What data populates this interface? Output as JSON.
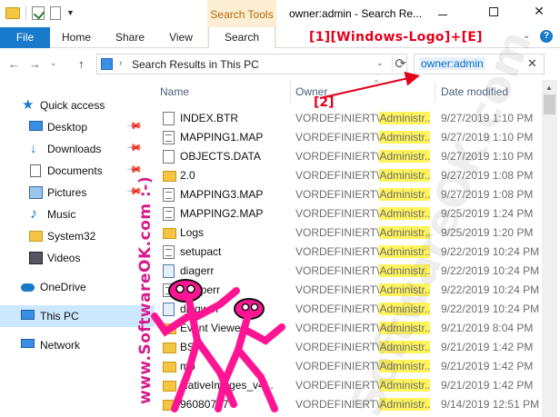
{
  "titlebar": {
    "title": "owner:admin - Search Re...",
    "contextual_group": "Search Tools",
    "minimize": "minimize",
    "maximize": "maximize",
    "close": "✕"
  },
  "ribbon": {
    "tabs": {
      "file": "File",
      "home": "Home",
      "share": "Share",
      "view": "View",
      "search": "Search"
    },
    "expand": "⌄",
    "help": "?"
  },
  "annotation": {
    "shortcut": "[1][Windows-Logo]+[E]",
    "step2": "[2]",
    "side_watermark": "www.SoftwareOK.com :-)",
    "diagonal_watermark": "SoftwareOK.com"
  },
  "address": {
    "back": "←",
    "forward": "→",
    "recent": "⌄",
    "up": "↑",
    "path": "Search Results in This PC",
    "dropdown": "⌄",
    "refresh": "⟳"
  },
  "search": {
    "value": "owner:admin",
    "clear": "✕"
  },
  "sidebar": {
    "pin": "📌",
    "items": [
      {
        "label": "Quick access",
        "icon": "star-icon",
        "pinned": false
      },
      {
        "label": "Desktop",
        "icon": "desktop-icon",
        "pinned": true
      },
      {
        "label": "Downloads",
        "icon": "download-icon",
        "pinned": true
      },
      {
        "label": "Documents",
        "icon": "documents-icon",
        "pinned": true
      },
      {
        "label": "Pictures",
        "icon": "pictures-icon",
        "pinned": true
      },
      {
        "label": "Music",
        "icon": "music-icon",
        "pinned": false
      },
      {
        "label": "System32",
        "icon": "folder-icon",
        "pinned": false
      },
      {
        "label": "Videos",
        "icon": "videos-icon",
        "pinned": false
      },
      {
        "label": "OneDrive",
        "icon": "onedrive-icon",
        "pinned": false
      },
      {
        "label": "This PC",
        "icon": "this-pc-icon",
        "pinned": false,
        "selected": true
      },
      {
        "label": "Network",
        "icon": "network-icon",
        "pinned": false
      }
    ]
  },
  "columns": {
    "name": "Name",
    "owner": "Owner",
    "date_modified": "Date modified",
    "sort": "^"
  },
  "owner_prefix": "VORDEFINIERT\\",
  "owner_highlight": "Administr...",
  "files": [
    {
      "name": "INDEX.BTR",
      "type": "file",
      "date": "9/27/2019 1:10 PM"
    },
    {
      "name": "MAPPING1.MAP",
      "type": "fileline",
      "date": "9/27/2019 1:10 PM"
    },
    {
      "name": "OBJECTS.DATA",
      "type": "file",
      "date": "9/27/2019 1:10 PM"
    },
    {
      "name": "2.0",
      "type": "folder",
      "date": "9/27/2019 1:08 PM"
    },
    {
      "name": "MAPPING3.MAP",
      "type": "fileline",
      "date": "9/27/2019 1:08 PM"
    },
    {
      "name": "MAPPING2.MAP",
      "type": "fileline",
      "date": "9/25/2019 1:24 PM"
    },
    {
      "name": "Logs",
      "type": "folder",
      "date": "9/25/2019 1:20 PM"
    },
    {
      "name": "setupact",
      "type": "fileline",
      "date": "9/22/2019 10:24 PM"
    },
    {
      "name": "diagerr",
      "type": "setup",
      "date": "9/22/2019 10:24 PM"
    },
    {
      "name": "setuperr",
      "type": "fileline",
      "date": "9/22/2019 10:24 PM"
    },
    {
      "name": "diagwrn",
      "type": "setup",
      "date": "9/22/2019 10:24 PM"
    },
    {
      "name": "Event Viewer",
      "type": "folder",
      "date": "9/21/2019 8:04 PM"
    },
    {
      "name": "BS",
      "type": "folder",
      "date": "9/21/2019 1:42 PM"
    },
    {
      "name": "mp",
      "type": "folder",
      "date": "9/21/2019 1:42 PM"
    },
    {
      "name": "NativeImages_v4...",
      "type": "folder",
      "date": "9/21/2019 1:42 PM"
    },
    {
      "name": "96080727",
      "type": "folder",
      "date": "9/14/2019 12:51 PM"
    }
  ],
  "colors": {
    "accent": "#1979ca",
    "contextual": "#fbeed3",
    "annotation_red": "#e3001b",
    "highlight": "#fff45c",
    "watermark_pink": "#d81b8c"
  }
}
